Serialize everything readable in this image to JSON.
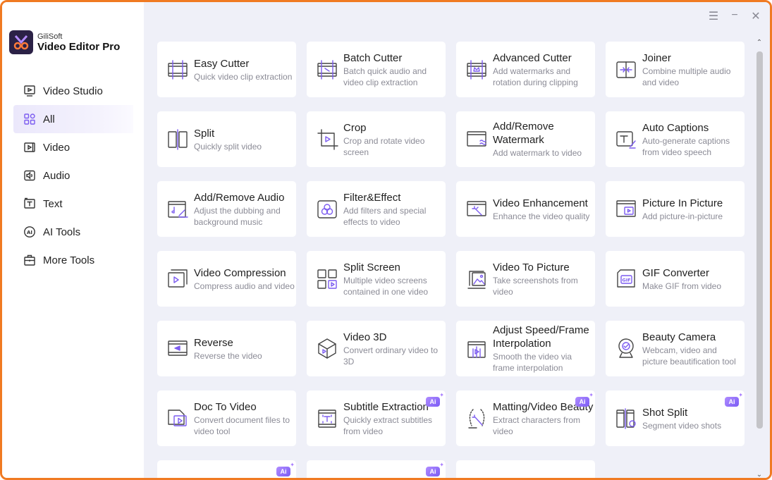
{
  "app": {
    "brand_small": "GiliSoft",
    "brand_big": "Video Editor Pro",
    "accent": "#7c5cf0",
    "frame": "#f07a22"
  },
  "sidebar": {
    "items": [
      {
        "label": "Video Studio",
        "icon": "video-studio-icon"
      },
      {
        "label": "All",
        "icon": "all-grid-icon",
        "active": true
      },
      {
        "label": "Video",
        "icon": "video-icon"
      },
      {
        "label": "Audio",
        "icon": "audio-icon"
      },
      {
        "label": "Text",
        "icon": "text-icon"
      },
      {
        "label": "AI Tools",
        "icon": "ai-icon"
      },
      {
        "label": "More Tools",
        "icon": "toolbox-icon"
      }
    ]
  },
  "window_controls": {
    "menu": "☰",
    "minimize": "−",
    "close": "✕"
  },
  "tools": [
    {
      "title": "Easy Cutter",
      "desc": "Quick video clip extraction",
      "icon": "film-cut-icon"
    },
    {
      "title": "Batch Cutter",
      "desc": "Batch quick audio and video clip extraction",
      "icon": "batch-cut-icon"
    },
    {
      "title": "Advanced Cutter",
      "desc": "Add watermarks and rotation during clipping",
      "icon": "advanced-cut-icon"
    },
    {
      "title": "Joiner",
      "desc": "Combine multiple audio and video",
      "icon": "joiner-icon"
    },
    {
      "title": "Split",
      "desc": "Quickly split video",
      "icon": "split-icon"
    },
    {
      "title": "Crop",
      "desc": "Crop and rotate video screen",
      "icon": "crop-icon"
    },
    {
      "title": "Add/Remove Watermark",
      "desc": "Add watermark to video",
      "icon": "watermark-icon"
    },
    {
      "title": "Auto Captions",
      "desc": "Auto-generate captions from video speech",
      "icon": "captions-icon"
    },
    {
      "title": "Add/Remove Audio",
      "desc": "Adjust the dubbing and background music",
      "icon": "audio-edit-icon"
    },
    {
      "title": "Filter&Effect",
      "desc": "Add filters and special effects to video",
      "icon": "filter-icon"
    },
    {
      "title": "Video Enhancement",
      "desc": "Enhance the video quality",
      "icon": "enhance-icon"
    },
    {
      "title": "Picture In Picture",
      "desc": "Add picture-in-picture",
      "icon": "pip-icon"
    },
    {
      "title": "Video Compression",
      "desc": "Compress audio and video",
      "icon": "compress-icon"
    },
    {
      "title": "Split Screen",
      "desc": "Multiple video screens contained in one video",
      "icon": "split-screen-icon"
    },
    {
      "title": "Video To Picture",
      "desc": "Take screenshots from video",
      "icon": "video-to-picture-icon"
    },
    {
      "title": "GIF Converter",
      "desc": "Make GIF from video",
      "icon": "gif-icon"
    },
    {
      "title": "Reverse",
      "desc": "Reverse the video",
      "icon": "reverse-icon"
    },
    {
      "title": "Video 3D",
      "desc": "Convert ordinary video to 3D",
      "icon": "cube-3d-icon"
    },
    {
      "title": "Adjust Speed/Frame Interpolation",
      "desc": "Smooth the video via frame interpolation",
      "icon": "speed-icon"
    },
    {
      "title": "Beauty Camera",
      "desc": "Webcam, video and picture beautification tool",
      "icon": "webcam-icon"
    },
    {
      "title": "Doc To Video",
      "desc": "Convert document files to video tool",
      "icon": "doc-video-icon"
    },
    {
      "title": "Subtitle Extraction",
      "desc": "Quickly extract subtitles from video",
      "icon": "subtitle-extract-icon",
      "ai": "Ai"
    },
    {
      "title": "Matting/Video Beauty",
      "desc": "Extract characters from video",
      "icon": "matting-icon",
      "ai": "Ai"
    },
    {
      "title": "Shot Split",
      "desc": "Segment video shots",
      "icon": "shot-split-icon",
      "ai": "Ai"
    }
  ],
  "partial_cards": [
    {
      "ai": "Ai"
    },
    {
      "ai": "Ai"
    },
    {}
  ]
}
